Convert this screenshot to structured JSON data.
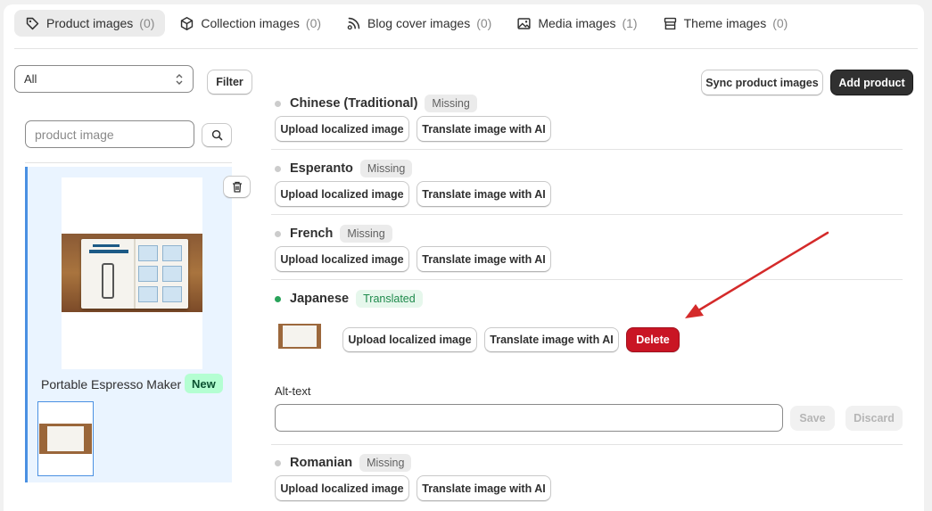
{
  "tabs": [
    {
      "label": "Product images",
      "count": "(0)",
      "icon": "tag-icon"
    },
    {
      "label": "Collection images",
      "count": "(0)",
      "icon": "cube-icon"
    },
    {
      "label": "Blog cover images",
      "count": "(0)",
      "icon": "blog-icon"
    },
    {
      "label": "Media images",
      "count": "(1)",
      "icon": "image-icon"
    },
    {
      "label": "Theme images",
      "count": "(0)",
      "icon": "theme-icon"
    }
  ],
  "filter": {
    "select_value": "All",
    "filter_label": "Filter"
  },
  "search": {
    "placeholder": "product image"
  },
  "toolbar": {
    "sync_label": "Sync product images",
    "add_label": "Add product"
  },
  "product": {
    "name": "Portable Espresso Maker",
    "badge": "New"
  },
  "languages": [
    {
      "name": "Chinese (Traditional)",
      "status": "Missing"
    },
    {
      "name": "Esperanto",
      "status": "Missing"
    },
    {
      "name": "French",
      "status": "Missing"
    },
    {
      "name": "Japanese",
      "status": "Translated"
    },
    {
      "name": "Romanian",
      "status": "Missing"
    }
  ],
  "actions": {
    "upload": "Upload localized image",
    "translate": "Translate image with AI",
    "delete": "Delete"
  },
  "alt": {
    "label": "Alt-text",
    "value": "",
    "save": "Save",
    "discard": "Discard"
  },
  "colors": {
    "accent": "#4a90e2",
    "danger": "#c91524",
    "arrow": "#d42a2a",
    "translated": "#29a35a"
  }
}
